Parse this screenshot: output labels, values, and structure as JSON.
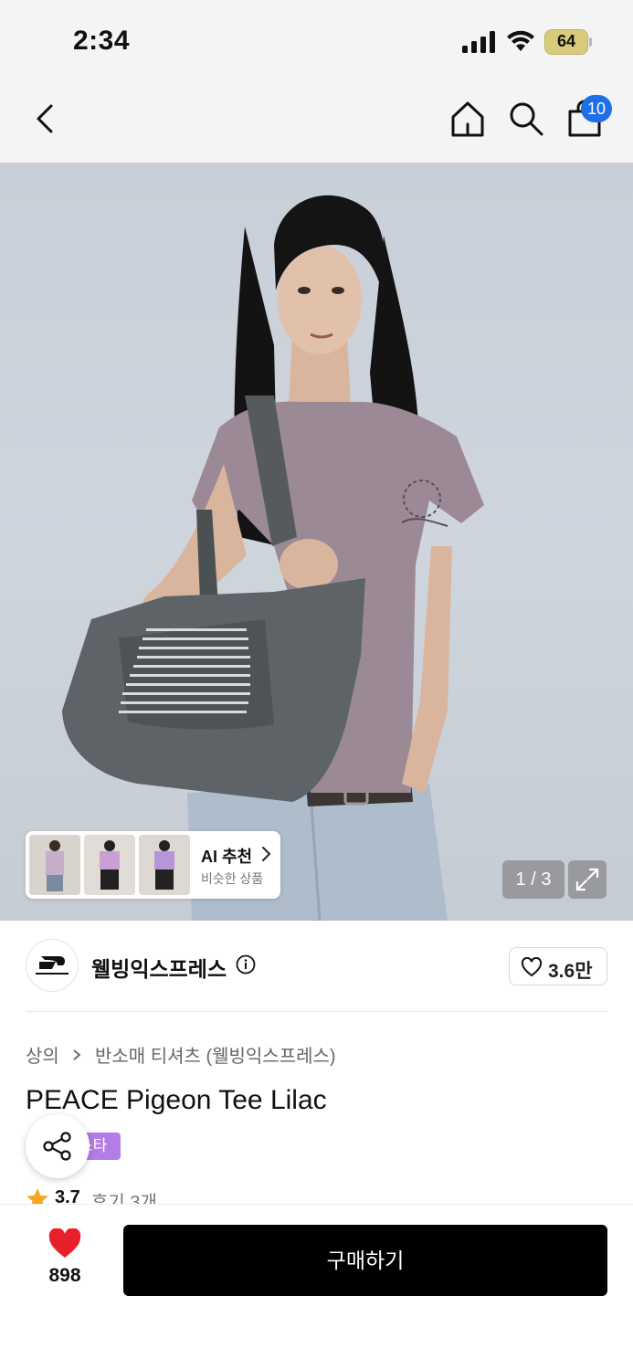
{
  "status_bar": {
    "time": "2:34",
    "battery": "64"
  },
  "nav": {
    "cart_count": "10"
  },
  "gallery": {
    "page_indicator": "1 / 3",
    "ai_title": "AI 추천",
    "ai_subtitle": "비슷한 상품"
  },
  "brand": {
    "name": "웰빙익스프레스",
    "like_count": "3.6만"
  },
  "breadcrumb": {
    "level1": "상의",
    "level2": "반소매 티셔츠 (웰빙익스프레스)"
  },
  "product": {
    "title": "PEACE Pigeon Tee Lilac",
    "tag": "스타",
    "rating": "3.7",
    "reviews": "후기 3개"
  },
  "bottom": {
    "wish_count": "898",
    "buy_label": "구매하기"
  },
  "colors": {
    "accent_blue": "#1f6fe8",
    "tag_purple": "#b37ce6",
    "heart_red": "#e8202a"
  }
}
